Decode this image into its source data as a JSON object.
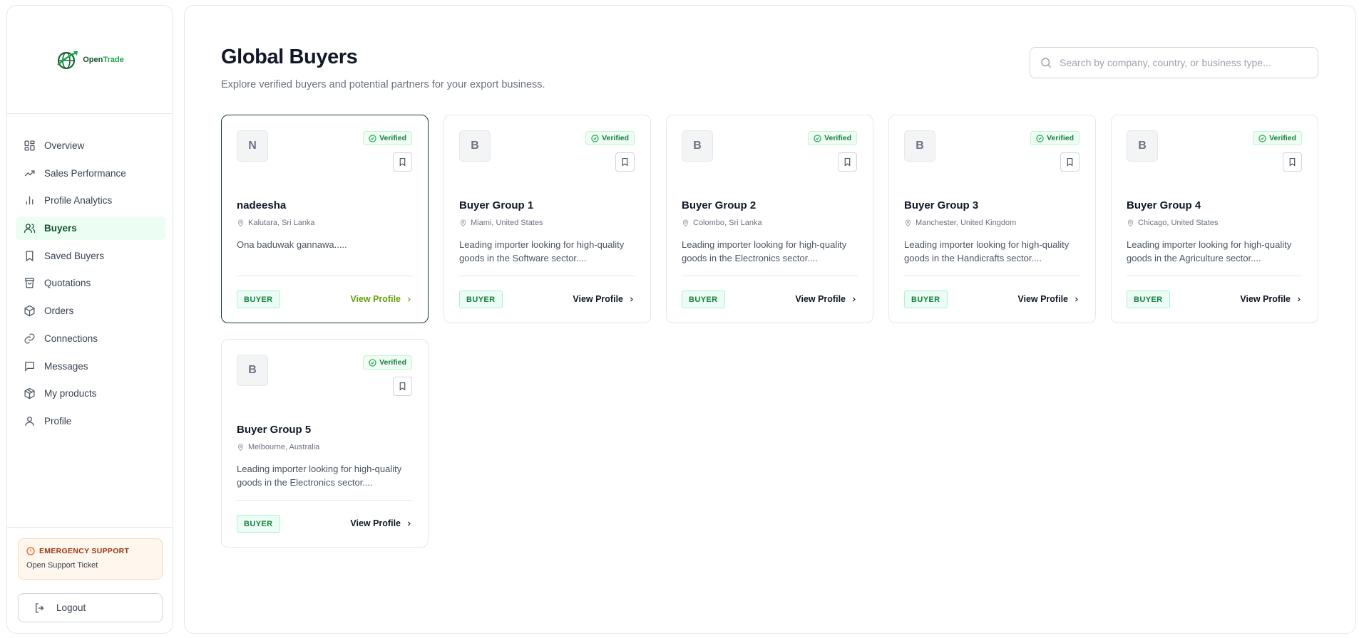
{
  "brand": {
    "name_part1": "Open",
    "name_part2": "Trade"
  },
  "sidebar": {
    "items": [
      {
        "label": "Overview",
        "icon": "overview-icon"
      },
      {
        "label": "Sales Performance",
        "icon": "trending-up-icon"
      },
      {
        "label": "Profile Analytics",
        "icon": "bar-chart-icon"
      },
      {
        "label": "Buyers",
        "icon": "users-icon",
        "active": true
      },
      {
        "label": "Saved Buyers",
        "icon": "bookmark-icon"
      },
      {
        "label": "Quotations",
        "icon": "shopping-bag-icon"
      },
      {
        "label": "Orders",
        "icon": "package-icon"
      },
      {
        "label": "Connections",
        "icon": "link-icon"
      },
      {
        "label": "Messages",
        "icon": "message-icon"
      },
      {
        "label": "My products",
        "icon": "box-icon"
      },
      {
        "label": "Profile",
        "icon": "user-icon"
      }
    ],
    "emergency": {
      "title": "EMERGENCY SUPPORT",
      "link": "Open Support Ticket"
    },
    "logout_label": "Logout"
  },
  "header": {
    "title": "Global Buyers",
    "subtitle": "Explore verified buyers and potential partners for your export business.",
    "search_placeholder": "Search by company, country, or business type..."
  },
  "buyers": [
    {
      "initial": "N",
      "name": "nadeesha",
      "location": "Kalutara, Sri Lanka",
      "description": "Ona baduwak gannawa.....",
      "verified": "Verified",
      "badge": "BUYER",
      "action": "View Profile"
    },
    {
      "initial": "B",
      "name": "Buyer Group 1",
      "location": "Miami, United States",
      "description": "Leading importer looking for high-quality goods in the Software sector....",
      "verified": "Verified",
      "badge": "BUYER",
      "action": "View Profile"
    },
    {
      "initial": "B",
      "name": "Buyer Group 2",
      "location": "Colombo, Sri Lanka",
      "description": "Leading importer looking for high-quality goods in the Electronics sector....",
      "verified": "Verified",
      "badge": "BUYER",
      "action": "View Profile"
    },
    {
      "initial": "B",
      "name": "Buyer Group 3",
      "location": "Manchester, United Kingdom",
      "description": "Leading importer looking for high-quality goods in the Handicrafts sector....",
      "verified": "Verified",
      "badge": "BUYER",
      "action": "View Profile"
    },
    {
      "initial": "B",
      "name": "Buyer Group 4",
      "location": "Chicago, United States",
      "description": "Leading importer looking for high-quality goods in the Agriculture sector....",
      "verified": "Verified",
      "badge": "BUYER",
      "action": "View Profile"
    },
    {
      "initial": "B",
      "name": "Buyer Group 5",
      "location": "Melbourne, Australia",
      "description": "Leading importer looking for high-quality goods in the Electronics sector....",
      "verified": "Verified",
      "badge": "BUYER",
      "action": "View Profile"
    }
  ],
  "colors": {
    "accent": "#16a34a",
    "active_bg": "#ecfdf3",
    "brand_dark": "#14532d",
    "view_profile_accent": "#65a30d"
  }
}
